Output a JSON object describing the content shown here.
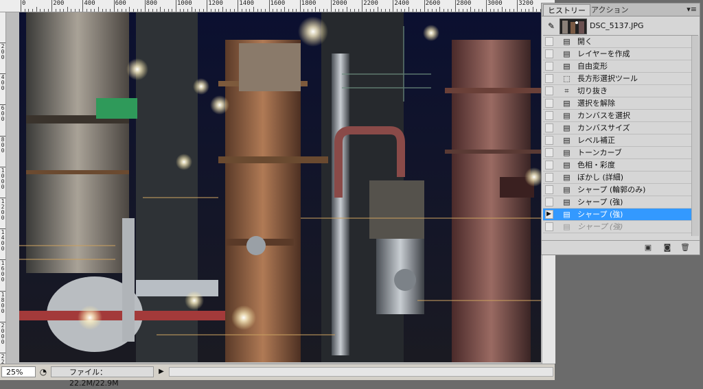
{
  "ruler": {
    "top_labels": [
      "0",
      "200",
      "400",
      "600",
      "800",
      "1000",
      "1200",
      "1400",
      "1600",
      "1800",
      "2000",
      "2200",
      "2400",
      "2600",
      "2800",
      "3000",
      "3200"
    ],
    "left_labels": [
      "2 0 0",
      "4 0 0",
      "6 0 0",
      "8 0 0",
      "1 0 0 0",
      "1 2 0 0",
      "1 4 0 0",
      "1 6 0 0",
      "1 8 0 0",
      "2 0 0 0",
      "2 2 0 0"
    ]
  },
  "status": {
    "zoom": "25%",
    "info": "ファイル：22.2M/22.9M",
    "icons": {
      "zoom_info": "info-icon",
      "arrow": "triangle-right-icon"
    }
  },
  "panel": {
    "tabs": [
      {
        "label": "ヒストリー",
        "active": true
      },
      {
        "label": "アクション",
        "active": false
      }
    ],
    "menu_icon": "panel-menu-icon",
    "snapshot": {
      "name": "DSC_5137.JPG",
      "icon": "history-brush-icon"
    },
    "items": [
      {
        "label": "開く",
        "icon": "document-icon",
        "state": "normal"
      },
      {
        "label": "レイヤーを作成",
        "icon": "document-icon",
        "state": "normal"
      },
      {
        "label": "自由変形",
        "icon": "document-icon",
        "state": "normal"
      },
      {
        "label": "長方形選択ツール",
        "icon": "marquee-icon",
        "state": "normal"
      },
      {
        "label": "切り抜き",
        "icon": "crop-icon",
        "state": "normal"
      },
      {
        "label": "選択を解除",
        "icon": "document-icon",
        "state": "normal"
      },
      {
        "label": "カンバスを選択",
        "icon": "document-icon",
        "state": "normal"
      },
      {
        "label": "カンバスサイズ",
        "icon": "document-icon",
        "state": "normal"
      },
      {
        "label": "レベル補正",
        "icon": "document-icon",
        "state": "normal"
      },
      {
        "label": "トーンカーブ",
        "icon": "document-icon",
        "state": "normal"
      },
      {
        "label": "色相・彩度",
        "icon": "document-icon",
        "state": "normal"
      },
      {
        "label": "ぼかし (詳細)",
        "icon": "document-icon",
        "state": "normal"
      },
      {
        "label": "シャープ (輪郭のみ)",
        "icon": "document-icon",
        "state": "normal"
      },
      {
        "label": "シャープ (強)",
        "icon": "document-icon",
        "state": "normal"
      },
      {
        "label": "シャープ (強)",
        "icon": "document-icon",
        "state": "selected"
      },
      {
        "label": "シャープ (強)",
        "icon": "document-icon",
        "state": "dim"
      }
    ],
    "footer_icons": [
      "new-document-from-state-icon",
      "camera-snapshot-icon",
      "trash-icon"
    ]
  },
  "colors": {
    "selection": "#3399ff",
    "panel_bg": "#d6d6d6",
    "workspace": "#6b6b6b"
  }
}
